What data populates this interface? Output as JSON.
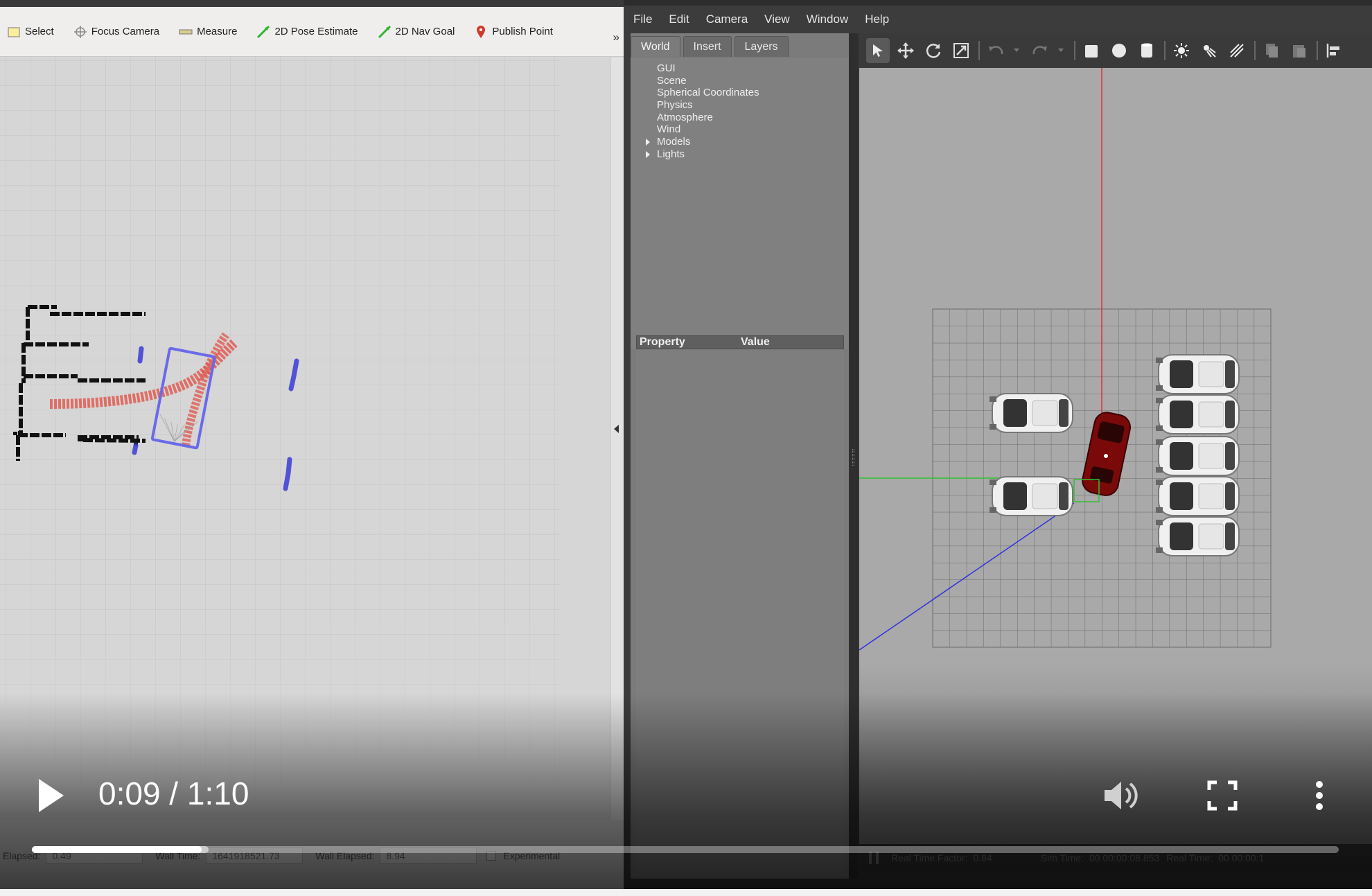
{
  "rviz": {
    "tools": [
      {
        "label": "Select",
        "icon": "select-icon"
      },
      {
        "label": "Focus Camera",
        "icon": "focus-camera-icon"
      },
      {
        "label": "Measure",
        "icon": "measure-icon"
      },
      {
        "label": "2D Pose Estimate",
        "icon": "pose-estimate-icon"
      },
      {
        "label": "2D Nav Goal",
        "icon": "nav-goal-icon"
      },
      {
        "label": "Publish Point",
        "icon": "publish-point-icon"
      }
    ],
    "more_label": "»",
    "status": {
      "ros_elapsed_label": "Elapsed:",
      "ros_elapsed_value": "0.49",
      "wall_time_label": "Wall Time:",
      "wall_time_value": "1641918521.73",
      "wall_elapsed_label": "Wall Elapsed:",
      "wall_elapsed_value": "8.94",
      "experimental_label": "Experimental"
    }
  },
  "gazebo": {
    "menu": [
      "File",
      "Edit",
      "Camera",
      "View",
      "Window",
      "Help"
    ],
    "tabs": [
      "World",
      "Insert",
      "Layers"
    ],
    "active_tab": "World",
    "tree": [
      {
        "label": "GUI",
        "expandable": false
      },
      {
        "label": "Scene",
        "expandable": false
      },
      {
        "label": "Spherical Coordinates",
        "expandable": false
      },
      {
        "label": "Physics",
        "expandable": false
      },
      {
        "label": "Atmosphere",
        "expandable": false
      },
      {
        "label": "Wind",
        "expandable": false
      },
      {
        "label": "Models",
        "expandable": true
      },
      {
        "label": "Lights",
        "expandable": true
      }
    ],
    "property_header": "Property",
    "value_header": "Value",
    "toolbar_icons": [
      "select-mode-icon",
      "translate-icon",
      "rotate-icon",
      "scale-icon",
      "undo-icon",
      "undo-dropdown-icon",
      "redo-icon",
      "redo-dropdown-icon",
      "box-icon",
      "sphere-icon",
      "cylinder-icon",
      "point-light-icon",
      "spot-light-icon",
      "directional-light-icon",
      "copy-icon",
      "paste-icon",
      "align-icon"
    ],
    "bottom": {
      "real_time_factor_label": "Real Time Factor:",
      "real_time_factor_value": "0.84",
      "sim_time_label": "Sim Time:",
      "sim_time_value": "00 00:00:08.853",
      "real_time_label": "Real Time:",
      "real_time_value": "00 00:00:1"
    }
  },
  "video": {
    "current_time": "0:09",
    "separator": " / ",
    "duration": "1:10",
    "played_fraction": 0.13,
    "buffered_fraction": 0.135,
    "play_icon": "play-icon",
    "volume_icon": "volume-icon",
    "fullscreen_icon": "fullscreen-icon",
    "more_icon": "more-options-icon"
  },
  "colors": {
    "laser_scan": "#3b3bd6",
    "planned_path": "#e0544a",
    "gazebo_x_axis": "#e03030",
    "gazebo_y_axis": "#30c030",
    "gazebo_z_axis": "#3030e0",
    "ego_car": "#7a0a0a"
  }
}
